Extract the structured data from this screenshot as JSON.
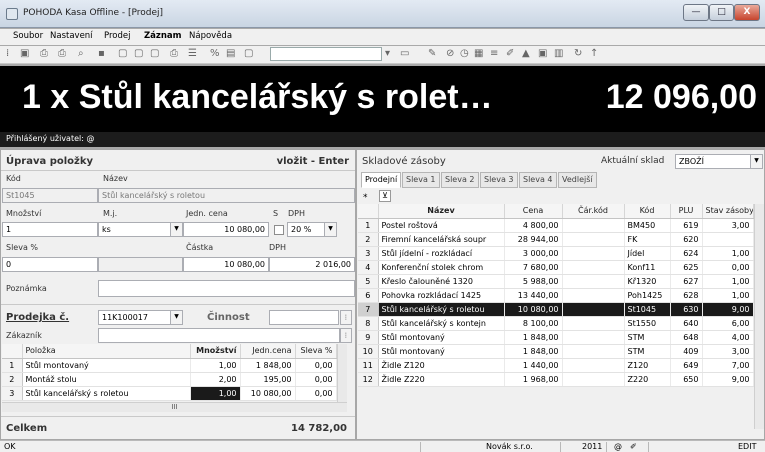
{
  "window": {
    "title": "POHODA Kasa Offline - [Prodej]",
    "min": "—",
    "max": "□",
    "close": "X"
  },
  "menu": [
    "Soubor",
    "Nastavení",
    "Prodej",
    "Záznam",
    "Nápověda"
  ],
  "display": {
    "left": "1 x  Stůl kancelářský s rolet…",
    "right": "12 096,00"
  },
  "user": {
    "label": "Přihlášený uživatel: @"
  },
  "edit": {
    "header": "Úprava položky",
    "action": "vložit - Enter",
    "name_label": "Název",
    "code_label": "Kód",
    "code": "St1045",
    "name": "Stůl kancelářský s roletou",
    "qty_label": "Množství",
    "unit_label": "M.j.",
    "price_label": "Jedn. cena",
    "s_label": "S",
    "vat_label": "DPH",
    "qty": "1",
    "unit": "ks",
    "price": "10 080,00",
    "vat": "20 %",
    "discount_label": "Sleva %",
    "amount_label": "Částka",
    "vat2_label": "DPH",
    "discount": "0",
    "amount": "10 080,00",
    "vat_amount": "2 016,00",
    "note_label": "Poznámka"
  },
  "receipt": {
    "label": "Prodejka č.",
    "number": "11K100017",
    "activity_label": "Činnost",
    "customer_label": "Zákazník",
    "columns": [
      "Položka",
      "Množství",
      "Jedn.cena",
      "Sleva %"
    ],
    "rows": [
      {
        "n": "1",
        "name": "Stůl montovaný",
        "qty": "1,00",
        "price": "1 848,00",
        "disc": "0,00"
      },
      {
        "n": "2",
        "name": "Montáž stolu",
        "qty": "2,00",
        "price": "195,00",
        "disc": "0,00"
      },
      {
        "n": "3",
        "name": "Stůl kancelářský s roletou",
        "qty": "1,00",
        "price": "10 080,00",
        "disc": "0,00"
      }
    ],
    "scroll_thumb": "III",
    "total_label": "Celkem",
    "total": "14 782,00"
  },
  "stock": {
    "header": "Skladové zásoby",
    "current_label": "Aktuální sklad",
    "current": "ZBOŽÍ",
    "tabs": [
      "Prodejní",
      "Sleva 1",
      "Sleva 2",
      "Sleva 3",
      "Sleva 4",
      "Vedlejší"
    ],
    "columns": [
      "Název",
      "Cena",
      "Čár.kód",
      "Kód",
      "PLU",
      "Stav zásoby"
    ],
    "rows": [
      {
        "n": "1",
        "name": "Postel roštová",
        "price": "4 800,00",
        "bar": "",
        "code": "BM450",
        "plu": "619",
        "stock": "3,00"
      },
      {
        "n": "2",
        "name": "Firemní kancelářská soupr",
        "price": "28 944,00",
        "bar": "",
        "code": "FK",
        "plu": "620",
        "stock": ""
      },
      {
        "n": "3",
        "name": "Stůl jídelní - rozkládací",
        "price": "3 000,00",
        "bar": "",
        "code": "Jídel",
        "plu": "624",
        "stock": "1,00"
      },
      {
        "n": "4",
        "name": "Konferenční stolek chrom",
        "price": "7 680,00",
        "bar": "",
        "code": "Konf11",
        "plu": "625",
        "stock": "0,00"
      },
      {
        "n": "5",
        "name": "Křeslo čalouněné 1320",
        "price": "5 988,00",
        "bar": "",
        "code": "Kř1320",
        "plu": "627",
        "stock": "1,00"
      },
      {
        "n": "6",
        "name": "Pohovka rozkládací 1425",
        "price": "13 440,00",
        "bar": "",
        "code": "Poh1425",
        "plu": "628",
        "stock": "1,00"
      },
      {
        "n": "7",
        "name": "Stůl kancelářský s roletou",
        "price": "10 080,00",
        "bar": "",
        "code": "St1045",
        "plu": "630",
        "stock": "9,00"
      },
      {
        "n": "8",
        "name": "Stůl kancelářský s kontejn",
        "price": "8 100,00",
        "bar": "",
        "code": "St1550",
        "plu": "640",
        "stock": "6,00"
      },
      {
        "n": "9",
        "name": "Stůl montovaný",
        "price": "1 848,00",
        "bar": "",
        "code": "STM",
        "plu": "648",
        "stock": "4,00"
      },
      {
        "n": "10",
        "name": "Stůl montovaný",
        "price": "1 848,00",
        "bar": "",
        "code": "STM",
        "plu": "409",
        "stock": "3,00"
      },
      {
        "n": "11",
        "name": "Židle Z120",
        "price": "1 440,00",
        "bar": "",
        "code": "Z120",
        "plu": "649",
        "stock": "7,00"
      },
      {
        "n": "12",
        "name": "Židle Z220",
        "price": "1 968,00",
        "bar": "",
        "code": "Z220",
        "plu": "650",
        "stock": "9,00"
      }
    ],
    "filter_star": "*",
    "filter_icon": "⊻"
  },
  "status": {
    "left": "OK",
    "company": "Novák s.r.o.",
    "year": "2011",
    "at": "@",
    "mode": "EDIT"
  }
}
